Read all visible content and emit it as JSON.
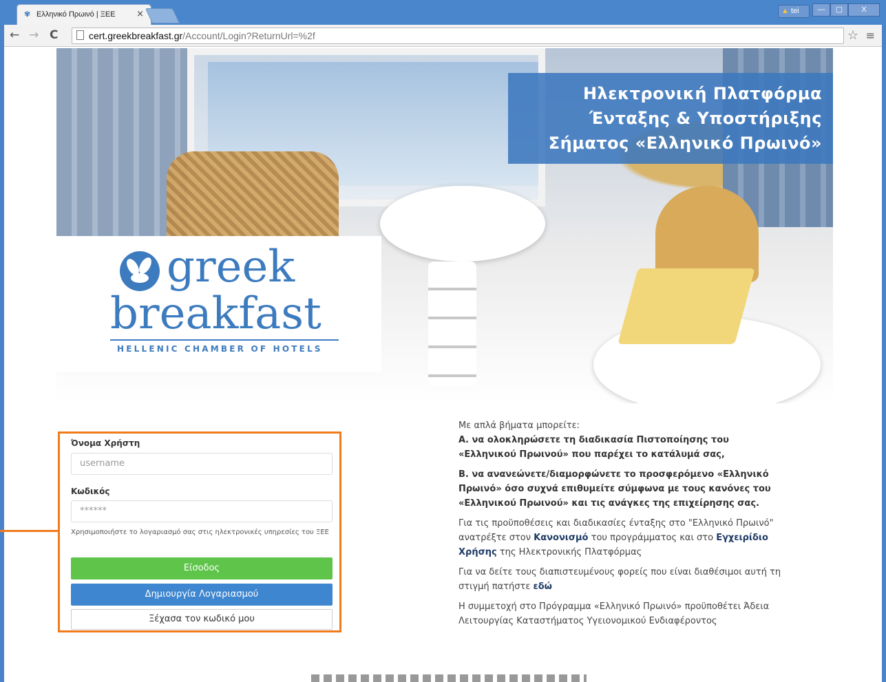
{
  "browser": {
    "tab_title": "Ελληνικό Πρωινό | ΞΕΕ",
    "tab_close": "×",
    "user_badge": "tei",
    "url_host": "cert.greekbreakfast.gr",
    "url_path": "/Account/Login?ReturnUrl=%2f",
    "back_icon": "←",
    "forward_icon": "→",
    "reload_icon": "C",
    "star_icon": "☆",
    "menu_icon": "≡",
    "minimize": "—",
    "maximize": "▢",
    "close": "X"
  },
  "hero": {
    "title_line1": "Ηλεκτρονική  Πλατφόρμα",
    "title_line2": "Ένταξης & Υποστήριξης",
    "title_line3": "Σήματος «Ελληνικό  Πρωινό»"
  },
  "logo": {
    "word1": "greek",
    "word2": "breakfast",
    "subtitle": "HELLENIC CHAMBER OF HOTELS"
  },
  "login": {
    "username_label": "Όνομα Χρήστη",
    "username_placeholder": "username",
    "password_label": "Κωδικός",
    "password_placeholder": "******",
    "hint": "Χρησιμοποιήστε το λογαριασμό σας στις ηλεκτρονικές υπηρεσίες του ΞΕΕ",
    "login_button": "Είσοδος",
    "register_button": "Δημιουργία Λογαριασμού",
    "forgot_button": "Ξέχασα τον κωδικό μου"
  },
  "info": {
    "intro": "Με απλά βήματα μπορείτε:",
    "step_a": "Α. να ολοκληρώσετε τη διαδικασία Πιστοποίησης του «Ελληνικού Πρωινού» που παρέχει το κατάλυμά σας,",
    "step_b": "Β. να ανανεώνετε/διαμορφώνετε το προσφερόμενο «Ελληνικό Πρωινό» όσο συχνά επιθυμείτε σύμφωνα με τους κανόνες του «Ελληνικού Πρωινού» και τις ανάγκες της επιχείρησης σας.",
    "para1_pre": "Για τις προϋποθέσεις και διαδικασίες ένταξης στο \"Ελληνικό Πρωινό\" ανατρέξτε στον ",
    "para1_link1": "Κανονισμό",
    "para1_mid": " του προγράμματος και στο ",
    "para1_link2": "Εγχειρίδιο Χρήσης",
    "para1_post": " της Ηλεκτρονικής Πλατφόρμας",
    "para2_pre": "Για να δείτε τους διαπιστευμένους φορείς που είναι διαθέσιμοι αυτή τη στιγμή πατήστε ",
    "para2_link": "εδώ",
    "para3": "Η συμμετοχή στο Πρόγραμμα «Ελληνικό Πρωινό» προϋποθέτει Άδεια Λειτουργίας Καταστήματος Υγειονομικού Ενδιαφέροντος"
  },
  "colors": {
    "accent_orange": "#f07b1c",
    "brand_blue": "#3d7bbf",
    "login_green": "#5ec44a",
    "register_blue": "#3e86cf"
  }
}
